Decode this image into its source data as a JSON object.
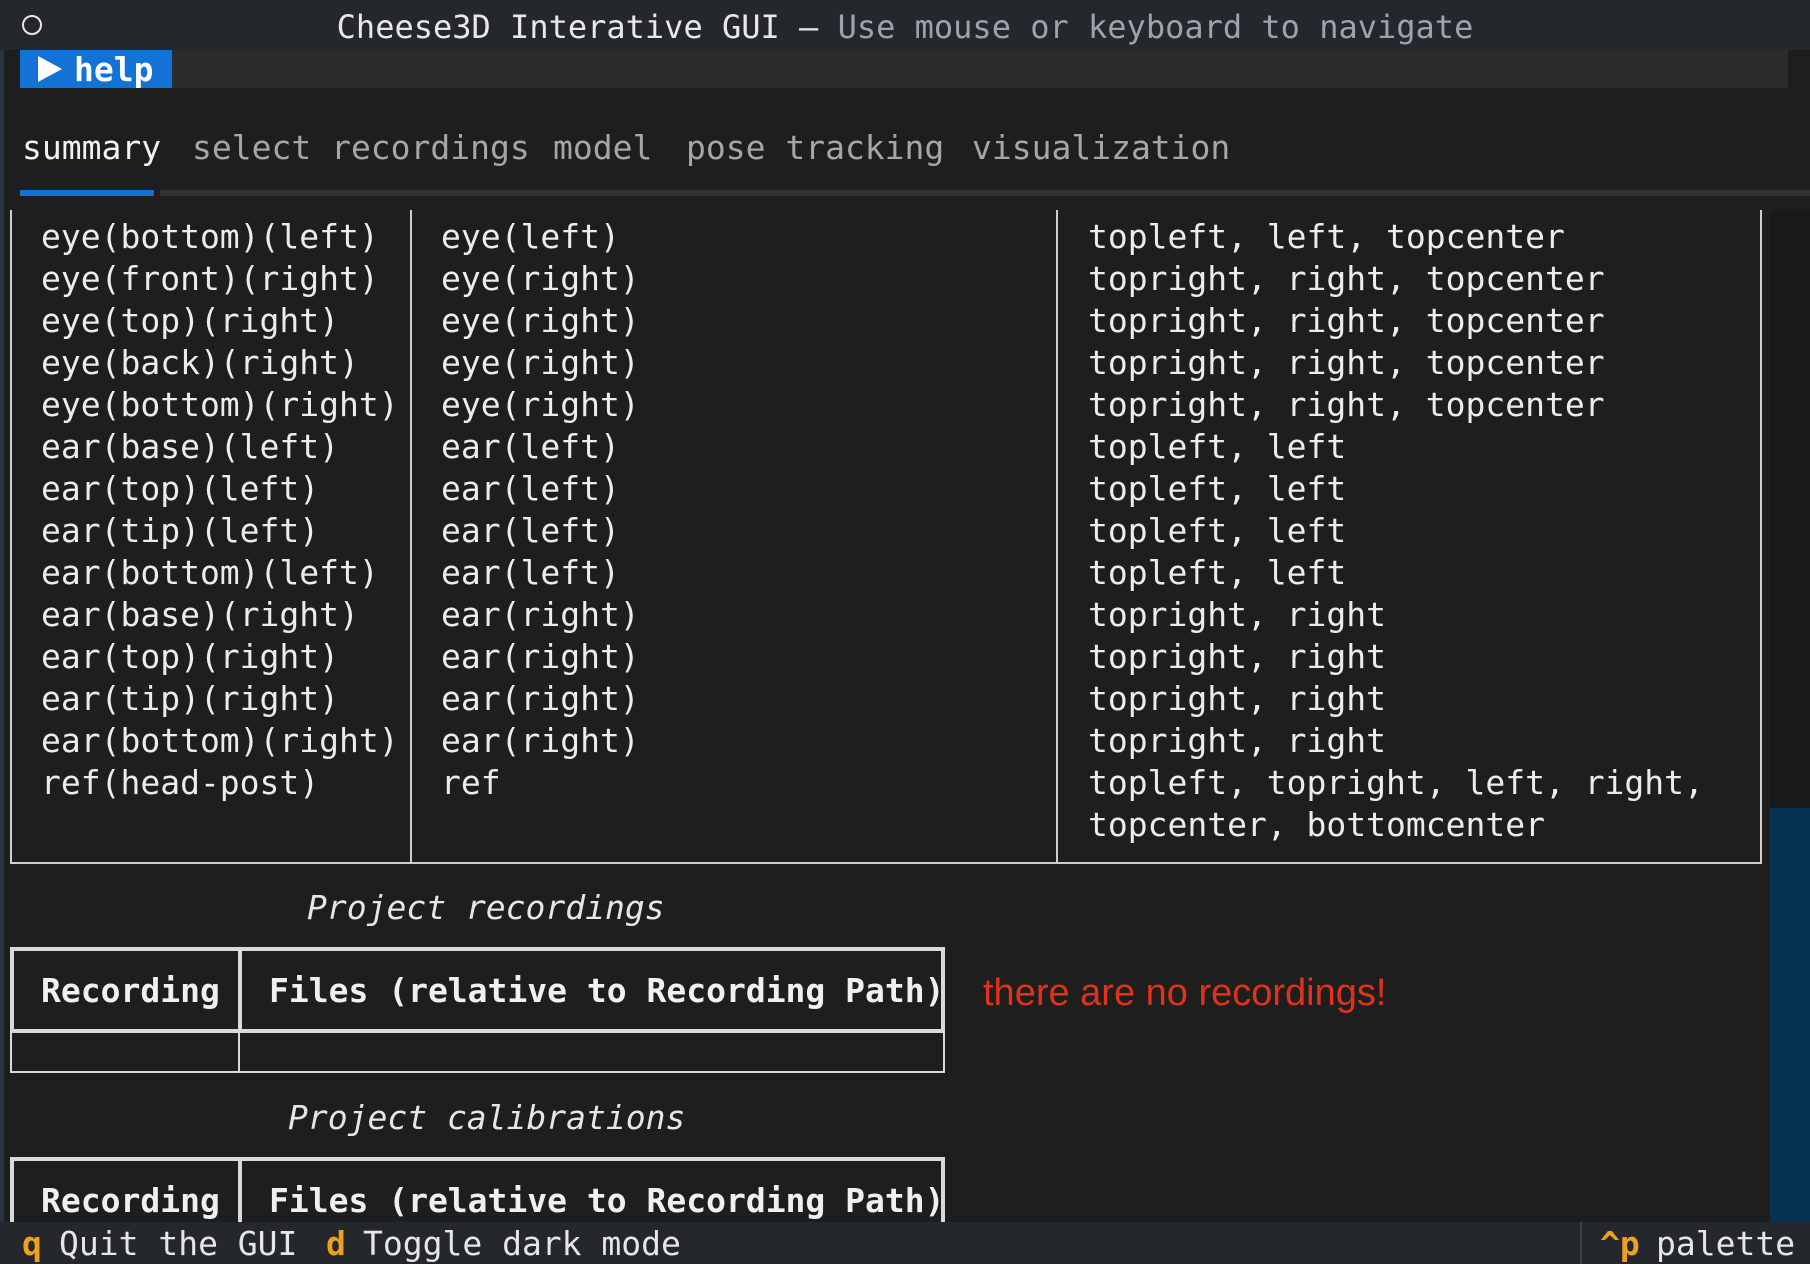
{
  "window": {
    "title_app": "Cheese3D Interative GUI",
    "title_sep": "—",
    "title_hint": "Use mouse or keyboard to navigate"
  },
  "help": {
    "label": "help"
  },
  "tabs": [
    {
      "label": "summary",
      "active": true
    },
    {
      "label": "select recordings",
      "active": false
    },
    {
      "label": "model",
      "active": false
    },
    {
      "label": "pose tracking",
      "active": false
    },
    {
      "label": "visualization",
      "active": false
    }
  ],
  "keypoints": {
    "col1": [
      "eye(bottom)(left)",
      "eye(front)(right)",
      "eye(top)(right)",
      "eye(back)(right)",
      "eye(bottom)(right)",
      "ear(base)(left)",
      "ear(top)(left)",
      "ear(tip)(left)",
      "ear(bottom)(left)",
      "ear(base)(right)",
      "ear(top)(right)",
      "ear(tip)(right)",
      "ear(bottom)(right)",
      "ref(head-post)",
      ""
    ],
    "col2": [
      "eye(left)",
      "eye(right)",
      "eye(right)",
      "eye(right)",
      "eye(right)",
      "ear(left)",
      "ear(left)",
      "ear(left)",
      "ear(left)",
      "ear(right)",
      "ear(right)",
      "ear(right)",
      "ear(right)",
      "ref",
      ""
    ],
    "col3": [
      "topleft, left, topcenter",
      "topright, right, topcenter",
      "topright, right, topcenter",
      "topright, right, topcenter",
      "topright, right, topcenter",
      "topleft, left",
      "topleft, left",
      "topleft, left",
      "topleft, left",
      "topright, right",
      "topright, right",
      "topright, right",
      "topright, right",
      "topleft, topright, left, right,",
      "topcenter, bottomcenter"
    ]
  },
  "recordings": {
    "caption": "Project recordings",
    "col_recording": "Recording",
    "col_files": "Files (relative to Recording Path)",
    "empty_message": "there are no recordings!"
  },
  "calibrations": {
    "caption": "Project calibrations",
    "col_recording": "Recording",
    "col_files": "Files (relative to Recording Path)"
  },
  "footer": {
    "quit_key": "q",
    "quit_label": "Quit the GUI",
    "dark_key": "d",
    "dark_label": "Toggle dark mode",
    "palette_key": "^p",
    "palette_label": "palette"
  },
  "colors": {
    "accent": "#1372d6",
    "error": "#e0321b",
    "footer_key": "#f0a020"
  }
}
